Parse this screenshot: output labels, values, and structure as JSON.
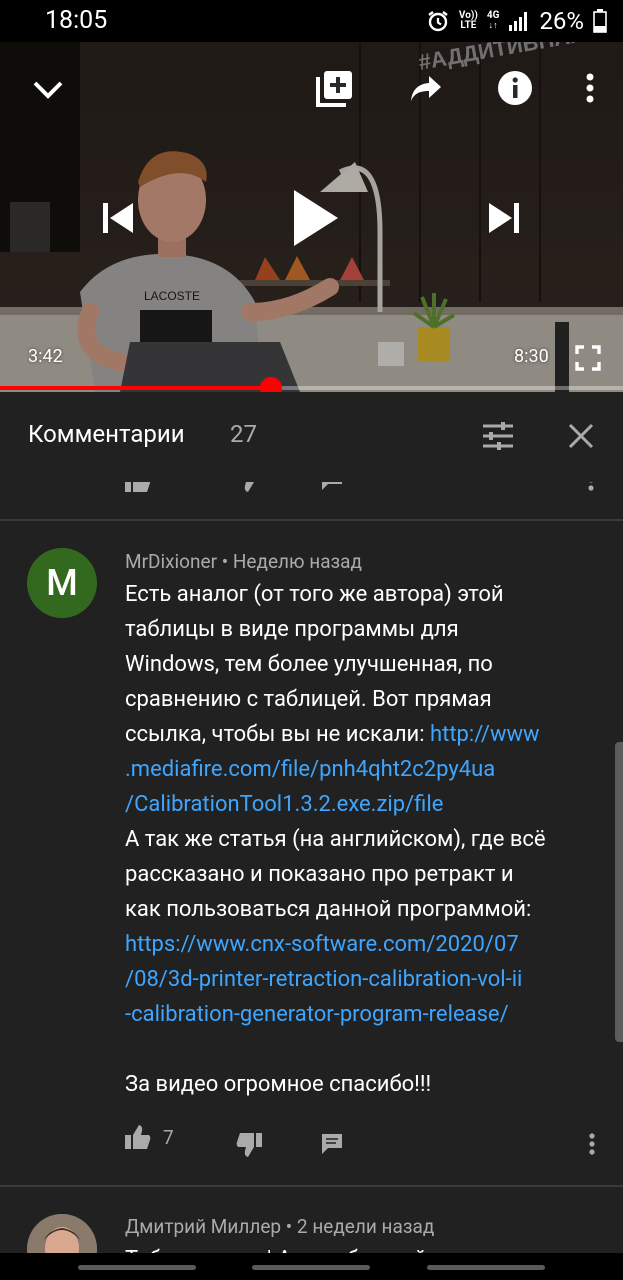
{
  "status_bar": {
    "time": "18:05",
    "volte_line1": "Vo))",
    "volte_line2": "LTE",
    "network": "4G",
    "battery_percent": "26%"
  },
  "player": {
    "current_time": "3:42",
    "duration": "8:30",
    "progress_fraction": 0.435,
    "watermark_text": "#АДДИТИВНАЯ КУХНЯ",
    "shirt_text": "LACOSTE"
  },
  "comments_panel": {
    "title": "Комментарии",
    "count": "27"
  },
  "comments": [
    {
      "author": "MrDixioner",
      "time": "Неделю назад",
      "avatar_letter": "M",
      "avatar_color": "#33691e",
      "lines": [
        [
          {
            "t": "Есть аналог (от того же автора) этой"
          }
        ],
        [
          {
            "t": "таблицы в виде программы для"
          }
        ],
        [
          {
            "t": "Windows, тем более улучшенная, по"
          }
        ],
        [
          {
            "t": "сравнению с таблицей. Вот прямая"
          }
        ],
        [
          {
            "t": "ссылка, чтобы вы не искали: "
          },
          {
            "t": "http://www",
            "link": true
          }
        ],
        [
          {
            "t": ".mediafire.com/file/pnh4qht2c2py4ua",
            "link": true
          }
        ],
        [
          {
            "t": "/CalibrationTool1.3.2.exe.zip/file",
            "link": true
          }
        ],
        [
          {
            "t": "А так же статья (на английском), где всё"
          }
        ],
        [
          {
            "t": "рассказано и показано про ретракт и"
          }
        ],
        [
          {
            "t": "как пользоваться данной программой:"
          }
        ],
        [
          {
            "t": "https://www.cnx-software.com/2020/07",
            "link": true
          }
        ],
        [
          {
            "t": "/08/3d-printer-retraction-calibration-vol-ii",
            "link": true
          }
        ],
        [
          {
            "t": "-calibration-generator-program-release/",
            "link": true
          }
        ],
        [],
        [
          {
            "t": "За видео огромное спасибо!!!"
          }
        ]
      ],
      "like_count": "7"
    },
    {
      "author": "Дмитрий Миллер",
      "time": "2 недели назад",
      "first_line_partial": "Таблица ……… | А ……… б ……… й"
    }
  ],
  "colors": {
    "panel_bg": "#212121",
    "link": "#3ea6ff",
    "secondary_text": "#aaaaaa",
    "progress": "#ff0000"
  }
}
